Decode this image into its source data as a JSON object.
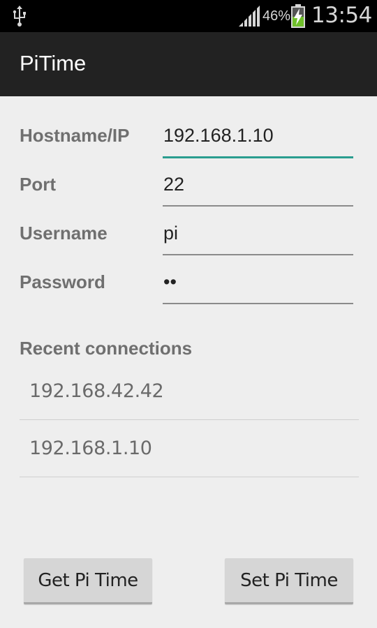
{
  "status_bar": {
    "battery_percent": "46%",
    "time": "13:54",
    "icons": [
      "usb-icon",
      "signal-icon",
      "battery-charging-icon"
    ]
  },
  "app": {
    "title": "PiTime"
  },
  "form": {
    "hostname": {
      "label": "Hostname/IP",
      "value": "192.168.1.10"
    },
    "port": {
      "label": "Port",
      "value": "22"
    },
    "username": {
      "label": "Username",
      "value": "pi"
    },
    "password": {
      "label": "Password",
      "value": "••"
    }
  },
  "recent": {
    "header": "Recent connections",
    "items": [
      "192.168.42.42",
      "192.168.1.10"
    ]
  },
  "buttons": {
    "get_label": "Get Pi Time",
    "set_label": "Set Pi Time"
  },
  "colors": {
    "accent": "#2a9d8f",
    "action_bar": "#222222",
    "background": "#eeeeee"
  }
}
